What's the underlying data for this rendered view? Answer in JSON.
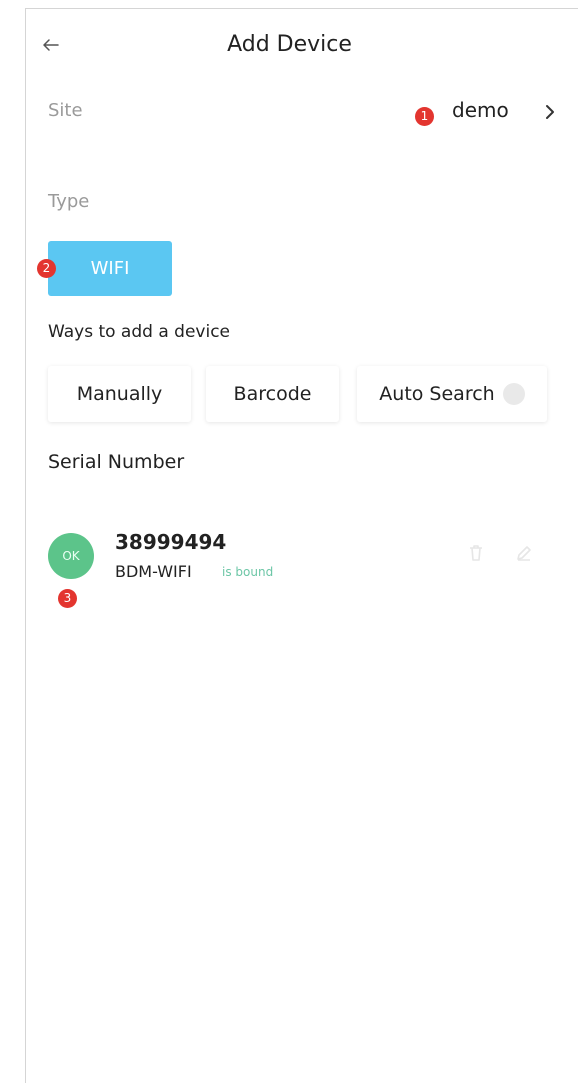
{
  "header": {
    "title": "Add Device"
  },
  "site": {
    "label": "Site",
    "value": "demo"
  },
  "type": {
    "label": "Type",
    "selected": "WIFI"
  },
  "ways": {
    "label": "Ways to add a device",
    "options": [
      "Manually",
      "Barcode",
      "Auto Search"
    ]
  },
  "serial": {
    "label": "Serial Number"
  },
  "device": {
    "status_badge": "OK",
    "serial_number": "38999494",
    "type": "BDM-WIFI",
    "bound_status": "is bound"
  },
  "annotations": [
    "1",
    "2",
    "3"
  ],
  "colors": {
    "accent": "#5bc7f2",
    "ok_green": "#5cc48a",
    "marker_red": "#e3352f",
    "bound_text": "#6cc6a6"
  },
  "icons": {
    "back": "arrow-left-icon",
    "chevron": "chevron-right-icon",
    "info": "info-icon",
    "delete": "trash-icon",
    "edit": "edit-icon"
  }
}
